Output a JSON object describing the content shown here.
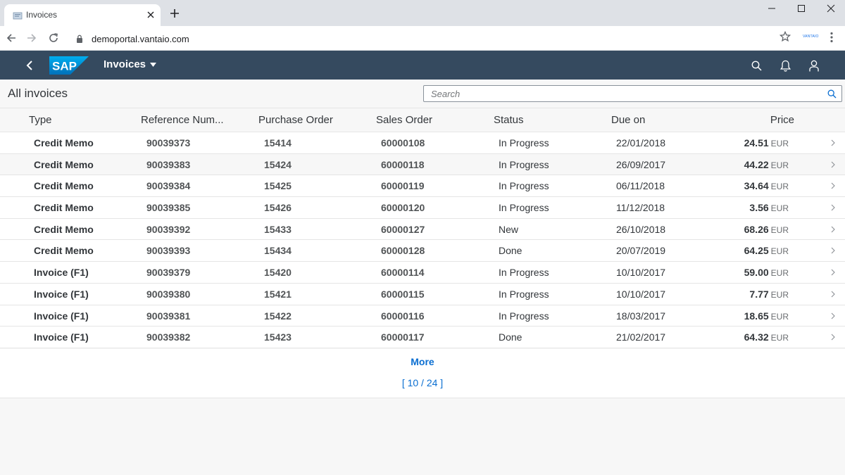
{
  "browser": {
    "tab_title": "Invoices",
    "url": "demoportal.vantaio.com",
    "extension_label": "VANTAIO"
  },
  "shell": {
    "app_title": "Invoices",
    "logo_text": "SAP"
  },
  "page": {
    "title": "All invoices",
    "search_placeholder": "Search"
  },
  "table": {
    "columns": [
      "Type",
      "Reference Num...",
      "Purchase Order",
      "Sales Order",
      "Status",
      "Due on",
      "Price"
    ],
    "rows": [
      {
        "type": "Credit Memo",
        "ref": "90039373",
        "po": "15414",
        "so": "60000108",
        "status": "In Progress",
        "due": "22/01/2018",
        "price": "24.51",
        "currency": "EUR"
      },
      {
        "type": "Credit Memo",
        "ref": "90039383",
        "po": "15424",
        "so": "60000118",
        "status": "In Progress",
        "due": "26/09/2017",
        "price": "44.22",
        "currency": "EUR"
      },
      {
        "type": "Credit Memo",
        "ref": "90039384",
        "po": "15425",
        "so": "60000119",
        "status": "In Progress",
        "due": "06/11/2018",
        "price": "34.64",
        "currency": "EUR"
      },
      {
        "type": "Credit Memo",
        "ref": "90039385",
        "po": "15426",
        "so": "60000120",
        "status": "In Progress",
        "due": "11/12/2018",
        "price": "3.56",
        "currency": "EUR"
      },
      {
        "type": "Credit Memo",
        "ref": "90039392",
        "po": "15433",
        "so": "60000127",
        "status": "New",
        "due": "26/10/2018",
        "price": "68.26",
        "currency": "EUR"
      },
      {
        "type": "Credit Memo",
        "ref": "90039393",
        "po": "15434",
        "so": "60000128",
        "status": "Done",
        "due": "20/07/2019",
        "price": "64.25",
        "currency": "EUR"
      },
      {
        "type": "Invoice (F1)",
        "ref": "90039379",
        "po": "15420",
        "so": "60000114",
        "status": "In Progress",
        "due": "10/10/2017",
        "price": "59.00",
        "currency": "EUR"
      },
      {
        "type": "Invoice (F1)",
        "ref": "90039380",
        "po": "15421",
        "so": "60000115",
        "status": "In Progress",
        "due": "10/10/2017",
        "price": "7.77",
        "currency": "EUR"
      },
      {
        "type": "Invoice (F1)",
        "ref": "90039381",
        "po": "15422",
        "so": "60000116",
        "status": "In Progress",
        "due": "18/03/2017",
        "price": "18.65",
        "currency": "EUR"
      },
      {
        "type": "Invoice (F1)",
        "ref": "90039382",
        "po": "15423",
        "so": "60000117",
        "status": "Done",
        "due": "21/02/2017",
        "price": "64.32",
        "currency": "EUR"
      }
    ]
  },
  "growing": {
    "more_label": "More",
    "count_label": "[ 10 / 24 ]"
  },
  "icons": {
    "tab_favicon": "document-icon",
    "back": "arrow-left-icon",
    "forward": "arrow-right-icon",
    "reload": "reload-icon",
    "lock": "lock-icon",
    "star": "star-icon",
    "menu": "more-vertical-icon",
    "shell_back": "chevron-left-icon",
    "shell_search": "search-icon",
    "notifications": "bell-icon",
    "user": "user-icon",
    "row_nav": "chevron-right-icon"
  },
  "colors": {
    "shell_bg": "#354a5f",
    "link": "#0a6ed1",
    "page_bg": "#f7f7f7",
    "sap_logo_blue": "#1a9de0"
  }
}
